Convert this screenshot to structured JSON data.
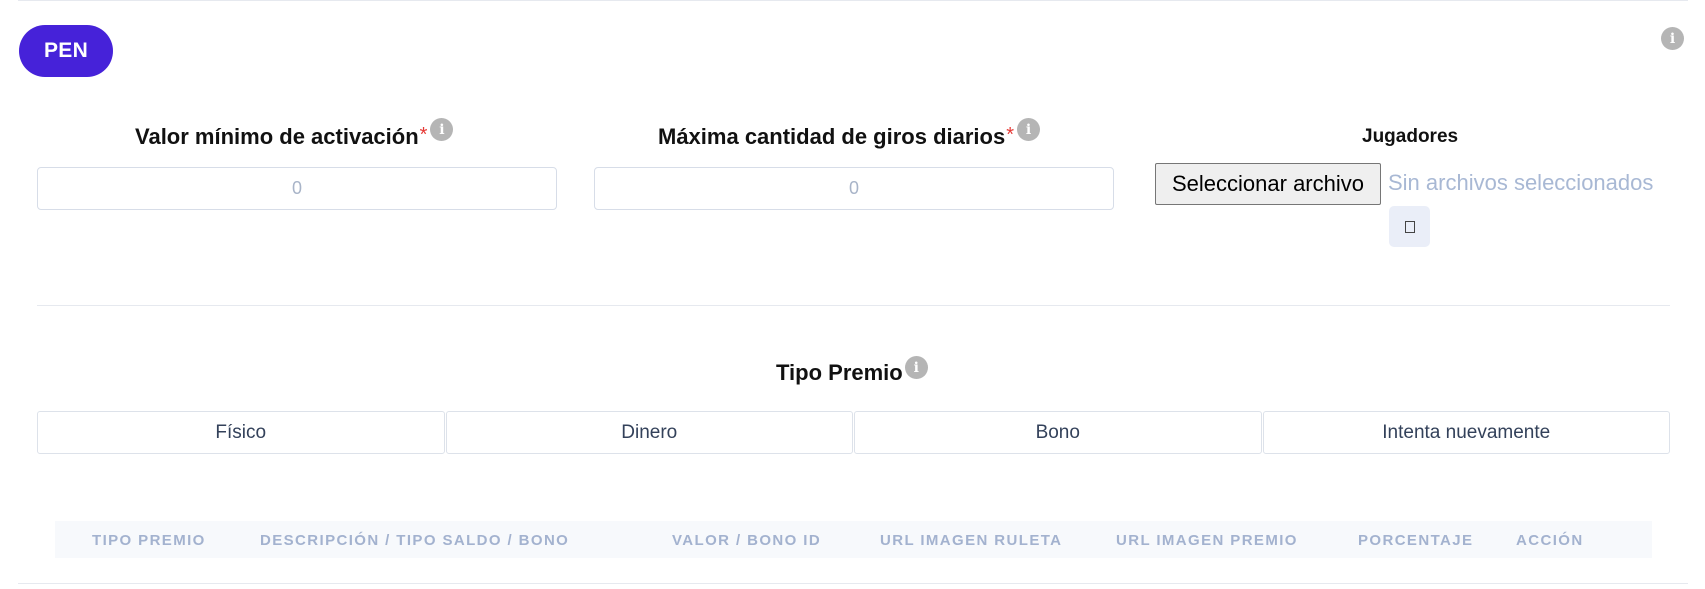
{
  "currency": {
    "label": "PEN"
  },
  "fields": {
    "min_activation": {
      "label": "Valor mínimo de activación",
      "required_mark": "*",
      "placeholder": "0"
    },
    "max_spins": {
      "label": "Máxima cantidad de giros diarios",
      "required_mark": "*",
      "placeholder": "0"
    }
  },
  "players": {
    "label": "Jugadores",
    "file_button": "Seleccionar archivo",
    "file_status": "Sin archivos seleccionados"
  },
  "prize_type": {
    "label": "Tipo Premio",
    "tabs": [
      "Físico",
      "Dinero",
      "Bono",
      "Intenta nuevamente"
    ]
  },
  "table": {
    "columns": [
      "TIPO PREMIO",
      "DESCRIPCIÓN / TIPO SALDO / BONO",
      "VALOR / BONO ID",
      "URL IMAGEN RULETA",
      "URL IMAGEN PREMIO",
      "PORCENTAJE",
      "ACCIÓN"
    ]
  },
  "icons": {
    "info": "info-icon",
    "upload": "upload-icon"
  },
  "colors": {
    "brand": "#4622d9",
    "required": "#e53935",
    "muted_text": "#a8b8d4"
  }
}
